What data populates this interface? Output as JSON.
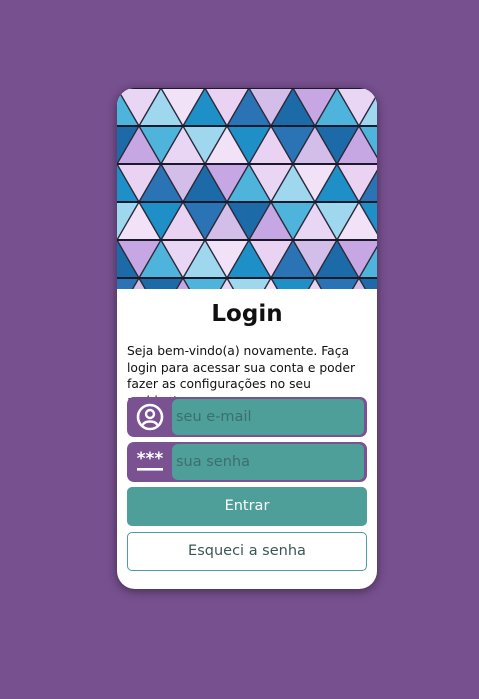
{
  "colors": {
    "page_background": "#77508f",
    "accent_purple": "#7a5191",
    "accent_teal": "#4e9e99",
    "card_background": "#ffffff"
  },
  "login": {
    "hero_image": "geometric-triangle-pattern",
    "title": "Login",
    "description": "Seja bem-vindo(a) novamente. Faça login para acessar sua conta e poder fazer as configurações no seu ambiente.",
    "email": {
      "icon": "user-circle-icon",
      "placeholder": "seu e-mail",
      "value": ""
    },
    "password": {
      "icon": "password-asterisks-icon",
      "placeholder": "sua senha",
      "value": ""
    },
    "submit_label": "Entrar",
    "forgot_label": "Esqueci a senha"
  }
}
